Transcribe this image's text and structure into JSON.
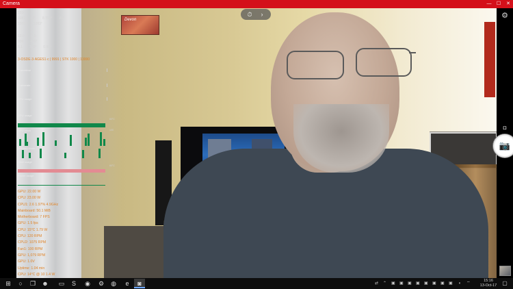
{
  "window": {
    "title": "Camera",
    "minimize": "—",
    "maximize": "☐",
    "close": "✕"
  },
  "camera": {
    "photo_timer_icon": "timer-icon",
    "expand_icon": "chevron-right-icon",
    "settings_icon": "gear-icon",
    "video_mode_icon": "video-camera-icon",
    "shutter_icon": "camera-icon",
    "gallery_icon": "photo-thumbnail"
  },
  "scene": {
    "picture_caption": "Devon"
  },
  "overlay": {
    "header": "3-OSDE·3·AGES1·c | 9991 | STK 1000 | 13000",
    "rows": [
      {
        "cells": [
          "1930",
          "",
          "",
          ""
        ]
      },
      {
        "cells": [
          "1081",
          "4°",
          "8.700°",
          "49°"
        ]
      },
      {
        "cells": [
          "10GB",
          "1083°",
          "",
          ""
        ]
      },
      {
        "cells": [
          "13.0",
          "0.0",
          "",
          ""
        ]
      },
      {
        "cells": [
          "900",
          "4.07",
          "",
          ""
        ]
      },
      {
        "cells": [
          "5.1",
          "100°",
          "0.81°",
          ""
        ]
      }
    ],
    "graphs": [
      {
        "label": "Frametime",
        "value": ""
      },
      {
        "label": "Framerate",
        "value": ""
      },
      {
        "label": "CPU usage",
        "value": ""
      },
      {
        "label": "GPU usage",
        "value": "60°C"
      },
      {
        "label": "GPU clock",
        "value": "100"
      },
      {
        "label": "Memory clock",
        "value": ""
      },
      {
        "label": "RAM usage",
        "value": "60°C"
      },
      {
        "label": "Power usage",
        "value": ""
      }
    ],
    "list": [
      "GPU: 22.00 W",
      "CPU: 23.00 W",
      "CPU1: 2.6 1.97% 4.9GHz",
      "Mainboard: 50.1 MiB",
      "Motherboard: 7 FPS",
      "GPU: 1.5 fps",
      "CPU: 15°C 1.79 W",
      "CPU: 120 RPM",
      "CPU2: 1075 RPM",
      "Fan1: 100 RPM",
      "GPU: 1,079 RPM",
      "GPU: 1.0V",
      "Uptime: 1.04 min",
      "CPU: 14°C @ 10 1.4 W"
    ]
  },
  "taskbar": {
    "start_icon": "windows-logo-icon",
    "search_icon": "search-icon",
    "taskview_icon": "task-view-icon",
    "apps": [
      "app-icon",
      "file-explorer-icon",
      "skype-icon",
      "media-player-icon",
      "settings-app-icon",
      "chrome-icon",
      "edge-icon",
      "camera-app-icon"
    ],
    "clock_time": "15:16",
    "clock_date": "13-Oct-17"
  },
  "colors": {
    "titlebar": "#d4101a",
    "overlay_orange": "#e0852a",
    "graph_green": "#10884a",
    "graph_pink": "#e38b93",
    "taskbar": "#0e0e0e"
  }
}
